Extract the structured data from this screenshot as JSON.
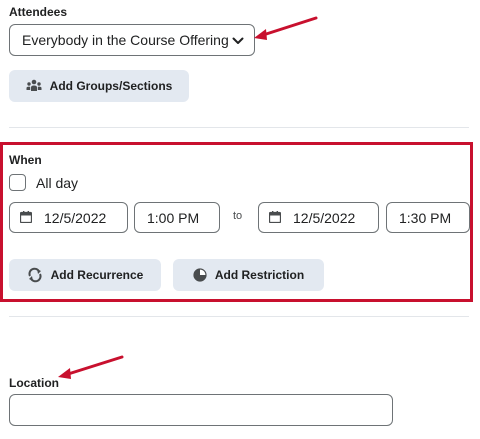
{
  "attendees": {
    "label": "Attendees",
    "selected": "Everybody in the Course Offering",
    "add_groups_label": "Add Groups/Sections"
  },
  "when": {
    "label": "When",
    "all_day_label": "All day",
    "start_date": "12/5/2022",
    "start_time": "1:00 PM",
    "to_label": "to",
    "end_date": "12/5/2022",
    "end_time": "1:30 PM",
    "add_recurrence_label": "Add Recurrence",
    "add_restriction_label": "Add Restriction"
  },
  "location": {
    "label": "Location",
    "value": ""
  },
  "icons": {
    "dropdown": "chevron-down-icon",
    "groups": "group-icon",
    "calendar": "calendar-icon",
    "recurrence": "recurrence-icon",
    "restriction": "restriction-icon",
    "annotation": "red-arrow-icon"
  },
  "colors": {
    "highlight": "#c8102e",
    "button_bg": "#e3e9f1",
    "border": "#6e7376"
  }
}
